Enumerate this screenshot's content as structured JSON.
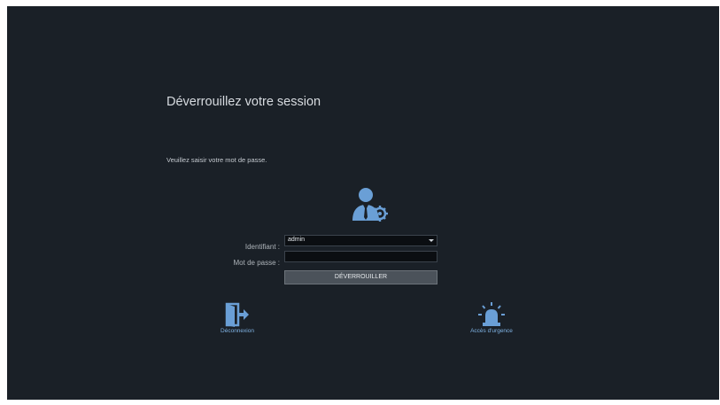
{
  "lock": {
    "title": "Déverrouillez votre session",
    "instruction": "Veuillez saisir votre mot de passe."
  },
  "form": {
    "username_label": "Identifiant :",
    "username_value": "admin",
    "password_label": "Mot de passe :",
    "password_value": "",
    "unlock_label": "DÉVERROUILLER"
  },
  "actions": {
    "logout_label": "Déconnexion",
    "emergency_label": "Accès d'urgence"
  },
  "icons": {
    "user": "user-admin-gear-icon",
    "logout": "logout-door-icon",
    "emergency": "emergency-beacon-icon"
  },
  "colors": {
    "background": "#1a2027",
    "accent": "#6a9fd6"
  }
}
